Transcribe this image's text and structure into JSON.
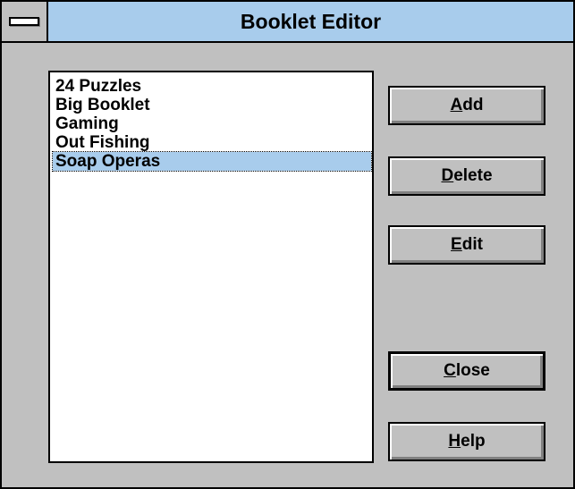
{
  "window": {
    "title": "Booklet Editor"
  },
  "booklets": [
    {
      "label": "24 Puzzles",
      "selected": false
    },
    {
      "label": "Big Booklet",
      "selected": false
    },
    {
      "label": "Gaming",
      "selected": false
    },
    {
      "label": "Out Fishing",
      "selected": false
    },
    {
      "label": "Soap Operas",
      "selected": true
    }
  ],
  "buttons": {
    "add": {
      "mnemonic": "A",
      "rest": "dd"
    },
    "delete": {
      "mnemonic": "D",
      "rest": "elete"
    },
    "edit": {
      "mnemonic": "E",
      "rest": "dit"
    },
    "close": {
      "mnemonic": "C",
      "rest": "lose"
    },
    "help": {
      "mnemonic": "H",
      "rest": "elp"
    }
  },
  "colors": {
    "titlebar": "#a8ccec",
    "selection": "#a8ccec",
    "dialog_face": "#c0c0c0"
  },
  "icons": {
    "system_menu": "system-menu-icon"
  }
}
